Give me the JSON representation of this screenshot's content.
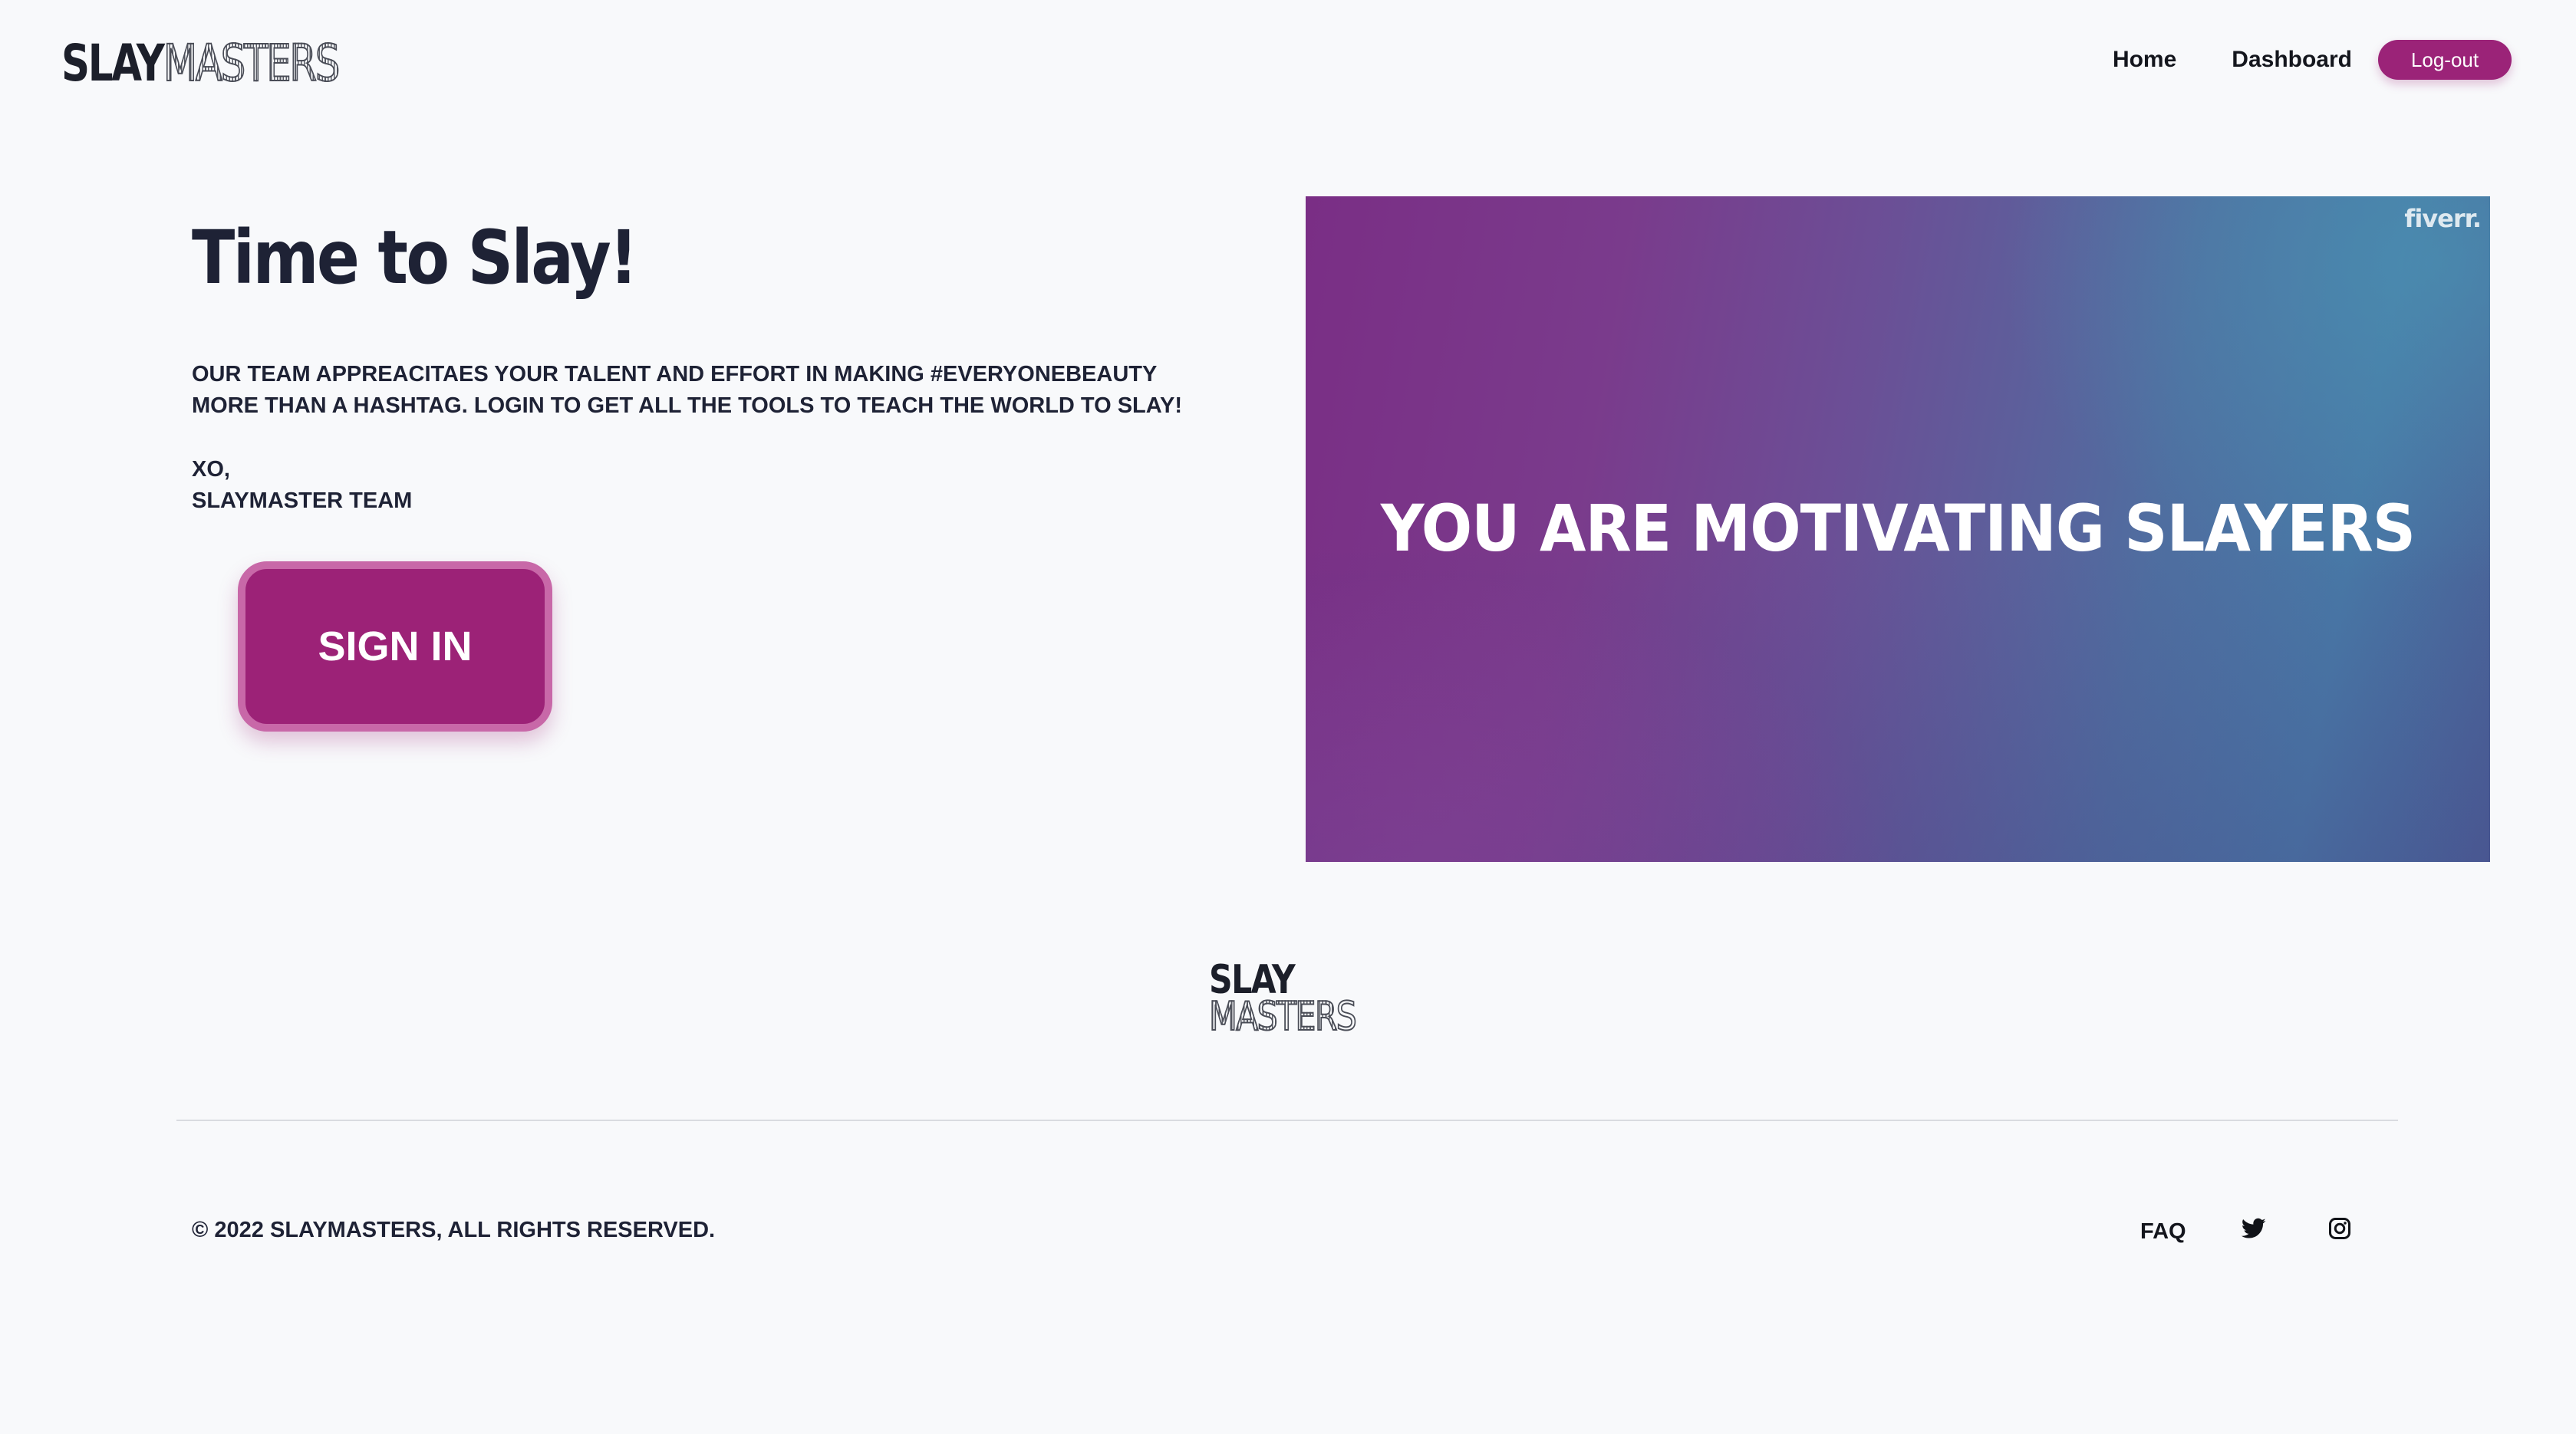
{
  "header": {
    "logo": {
      "part1": "SLAY",
      "part2": "MASTERS"
    },
    "nav": {
      "home": "Home",
      "dashboard": "Dashboard",
      "logout": "Log-out"
    }
  },
  "hero": {
    "title": "Time to Slay!",
    "message": "OUR TEAM APPREACITAES YOUR TALENT AND EFFORT IN MAKING #EVERYONEBEAUTY MORE THAN A HASHTAG. LOGIN TO GET ALL THE TOOLS TO TEACH THE WORLD TO SLAY!",
    "signoff_line1": "XO,",
    "signoff_line2": "SLAYMASTER TEAM",
    "signin_label": "SIGN IN"
  },
  "banner": {
    "headline": "YOU ARE MOTIVATING SLAYERS",
    "watermark": "fiverr."
  },
  "footer": {
    "logo": {
      "line1": "SLAY",
      "line2": "MASTERS"
    },
    "copyright": "© 2022 SLAYMASTERS, ALL RIGHTS RESERVED.",
    "faq": "FAQ",
    "icons": [
      "twitter-icon",
      "instagram-icon"
    ]
  },
  "colors": {
    "brand": "#9b2378",
    "brand_border": "#c868a8",
    "text": "#1e2235",
    "background": "#f8f9fb"
  }
}
